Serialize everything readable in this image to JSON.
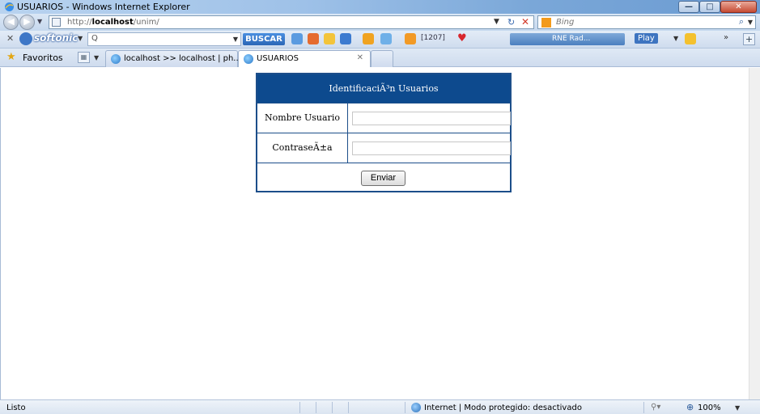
{
  "window": {
    "title": "USUARIOS - Windows Internet Explorer",
    "minimize": "—",
    "maximize": "□",
    "close": "✕"
  },
  "address_bar": {
    "url_prefix": "http://",
    "url_host": "localhost",
    "url_path": "/unim/",
    "search_placeholder": "Bing"
  },
  "toolbar": {
    "brand": "softonic",
    "search_glyph": "Q",
    "buscar": "BUSCAR",
    "badge": "[1207]",
    "radio": "RNE Rad...",
    "play": "Play"
  },
  "tabs": {
    "favorites": "Favoritos",
    "items": [
      {
        "label": "localhost >> localhost | ph..."
      },
      {
        "label": "USUARIOS"
      }
    ]
  },
  "form": {
    "header": "IdentificaciÃ³n Usuarios",
    "user_label": "Nombre Usuario",
    "password_label": "ContraseÃ±a",
    "submit": "Enviar",
    "user_value": "",
    "password_value": ""
  },
  "status_bar": {
    "status": "Listo",
    "zone": "Internet | Modo protegido: desactivado",
    "zoom": "100%"
  },
  "colors": {
    "form_header_bg": "#0d4a8e",
    "form_border": "#1c4e8a"
  }
}
